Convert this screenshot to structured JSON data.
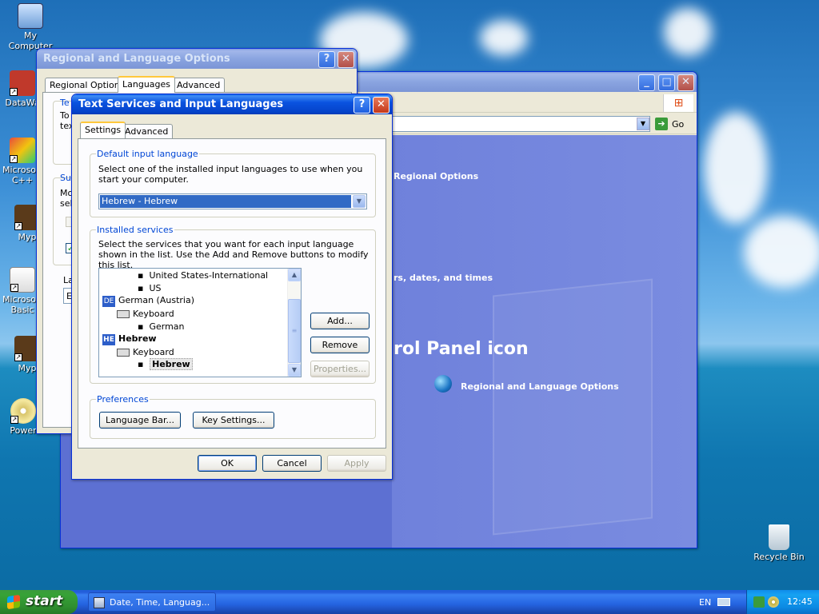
{
  "desktop": {
    "icons": [
      {
        "label": "My Computer"
      },
      {
        "label": "DataWa"
      },
      {
        "label": "Microsoft C++"
      },
      {
        "label": "Myp"
      },
      {
        "label": "Microsoft Basic"
      },
      {
        "label": "Myp"
      },
      {
        "label": "Power"
      }
    ],
    "recycle_bin": "Recycle Bin"
  },
  "cp_window": {
    "go_label": "Go",
    "nav_item": "Regional Options",
    "task": "rs, dates, and times",
    "heading": "rol Panel icon",
    "link": "Regional and Language Options"
  },
  "rlo": {
    "title": "Regional and Language Options",
    "tabs": [
      "Regional Options",
      "Languages",
      "Advanced"
    ],
    "frag1": "Te",
    "frag2": "To",
    "frag3": "tex",
    "frag4": "Su",
    "frag5": "Mo",
    "frag6": "sel",
    "frag7": "La",
    "frag8": "E"
  },
  "tsil": {
    "title": "Text Services and Input Languages",
    "tabs": [
      "Settings",
      "Advanced"
    ],
    "default_group": "Default input language",
    "default_desc": "Select one of the installed input languages to use when you start your computer.",
    "default_value": "Hebrew - Hebrew",
    "installed_group": "Installed services",
    "installed_desc": "Select the services that you want for each input language shown in the list. Use the Add and Remove buttons to modify this list.",
    "list": {
      "item1": "United States-International",
      "item2": "US",
      "lang1_code": "DE",
      "lang1": "German (Austria)",
      "keyboard1": "Keyboard",
      "item3": "German",
      "lang2_code": "HE",
      "lang2": "Hebrew",
      "keyboard2": "Keyboard",
      "item4": "Hebrew"
    },
    "add": "Add...",
    "remove": "Remove",
    "properties": "Properties...",
    "prefs_group": "Preferences",
    "language_bar": "Language Bar...",
    "key_settings": "Key Settings...",
    "ok": "OK",
    "cancel": "Cancel",
    "apply": "Apply"
  },
  "taskbar": {
    "start": "start",
    "task": "Date, Time, Languag...",
    "lang": "EN",
    "time": "12:45"
  }
}
